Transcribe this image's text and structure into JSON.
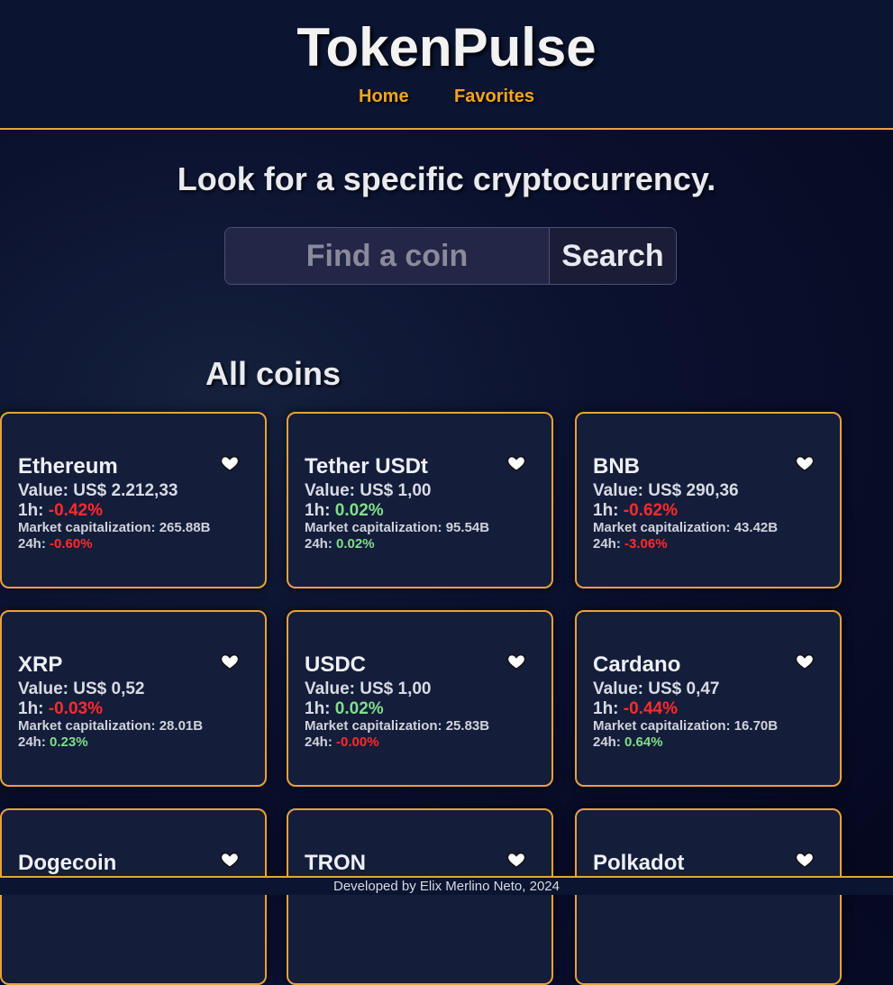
{
  "header": {
    "brand": "TokenPulse",
    "nav": [
      {
        "label": "Home"
      },
      {
        "label": "Favorites"
      }
    ]
  },
  "search": {
    "headline": "Look for a specific cryptocurrency.",
    "placeholder": "Find a coin",
    "button_label": "Search"
  },
  "coins_section": {
    "title": "All coins",
    "value_label": "Value:",
    "h1_label": "1h:",
    "market_cap_label": "Market capitalization:",
    "h24_label": "24h:",
    "coins": [
      {
        "name": "Ethereum",
        "value": "US$ 2.212,33",
        "h1": "-0.42%",
        "market_cap": "265.88B",
        "h24": "-0.60%"
      },
      {
        "name": "Tether USDt",
        "value": "US$ 1,00",
        "h1": "0.02%",
        "market_cap": "95.54B",
        "h24": "0.02%"
      },
      {
        "name": "BNB",
        "value": "US$ 290,36",
        "h1": "-0.62%",
        "market_cap": "43.42B",
        "h24": "-3.06%"
      },
      {
        "name": "XRP",
        "value": "US$ 0,52",
        "h1": "-0.03%",
        "market_cap": "28.01B",
        "h24": "0.23%"
      },
      {
        "name": "USDC",
        "value": "US$ 1,00",
        "h1": "0.02%",
        "market_cap": "25.83B",
        "h24": "-0.00%"
      },
      {
        "name": "Cardano",
        "value": "US$ 0,47",
        "h1": "-0.44%",
        "market_cap": "16.70B",
        "h24": "0.64%"
      },
      {
        "name": "Dogecoin"
      },
      {
        "name": "TRON"
      },
      {
        "name": "Polkadot"
      }
    ]
  },
  "colors": {
    "accent": "#f4a51c",
    "border": "#e8a23a",
    "negative": "#ff2a2a",
    "positive": "#7ee08a"
  },
  "icons": {
    "favorite": "heart-icon"
  },
  "footer": {
    "text": "Developed by Elix Merlino Neto, 2024"
  }
}
